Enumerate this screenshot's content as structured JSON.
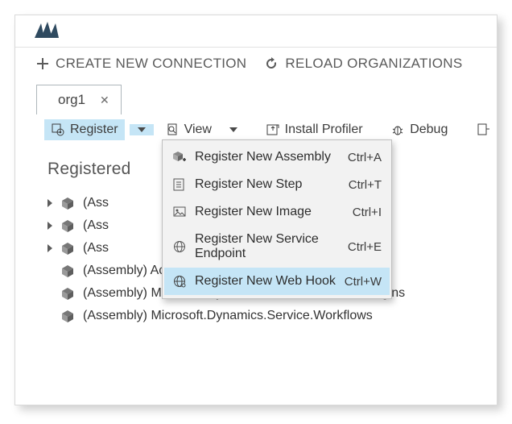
{
  "cmdbar": {
    "create_new_connection": "CREATE NEW CONNECTION",
    "reload_organizations": "RELOAD ORGANIZATIONS",
    "replay": "RE"
  },
  "tabs": [
    {
      "label": "org1"
    }
  ],
  "toolbar": {
    "register": "Register",
    "view": "View",
    "install_profiler": "Install Profiler",
    "debug": "Debug"
  },
  "content": {
    "heading": "Registered"
  },
  "tree": [
    "(Ass",
    "(Ass",
    "(Ass",
    "(Assembly) ActivityAnalysisPlugins.Merged",
    "(Assembly) Microsoft.Dynamics.CRMExtensions.Plugins",
    "(Assembly) Microsoft.Dynamics.Service.Workflows"
  ],
  "tree_suffix": {
    "row1": "s",
    "row2": "lugins"
  },
  "menu": [
    {
      "label": "Register New Assembly",
      "shortcut": "Ctrl+A",
      "icon": "assembly"
    },
    {
      "label": "Register New Step",
      "shortcut": "Ctrl+T",
      "icon": "step"
    },
    {
      "label": "Register New Image",
      "shortcut": "Ctrl+I",
      "icon": "image"
    },
    {
      "label": "Register New Service Endpoint",
      "shortcut": "Ctrl+E",
      "icon": "endpoint"
    },
    {
      "label": "Register New Web Hook",
      "shortcut": "Ctrl+W",
      "icon": "webhook",
      "hover": true
    }
  ]
}
